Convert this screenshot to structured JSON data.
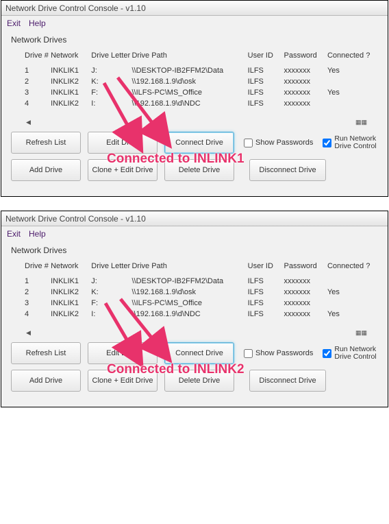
{
  "window_title": "Network Drive Control Console - v1.10",
  "menu": {
    "exit": "Exit",
    "help": "Help"
  },
  "section_label": "Network Drives",
  "columns": {
    "num": "Drive #",
    "net": "Network",
    "letter": "Drive Letter",
    "path": "Drive Path",
    "uid": "User ID",
    "pwd": "Password",
    "conn": "Connected ?"
  },
  "scroll": {
    "left": "◀",
    "right": "▦▦"
  },
  "buttons": {
    "refresh": "Refresh List",
    "edit": "Edit Drive",
    "connect": "Connect Drive",
    "add": "Add Drive",
    "clone": "Clone + Edit Drive",
    "delete": "Delete Drive",
    "disconnect": "Disconnect Drive"
  },
  "checks": {
    "show_pwd": "Show Passwords",
    "run_line1": "Run Network",
    "run_line2": "Drive Control"
  },
  "panel1": {
    "rows": [
      {
        "num": "1",
        "net": "INKLIK1",
        "letter": "J:",
        "path": "\\\\DESKTOP-IB2FFM2\\Data",
        "uid": "ILFS",
        "pwd": "xxxxxxx",
        "conn": "Yes"
      },
      {
        "num": "2",
        "net": "INKLIK2",
        "letter": "K:",
        "path": "\\\\192.168.1.9\\d\\osk",
        "uid": "ILFS",
        "pwd": "xxxxxxx",
        "conn": ""
      },
      {
        "num": "3",
        "net": "INKLIK1",
        "letter": "F:",
        "path": "\\\\ILFS-PC\\MS_Office",
        "uid": "ILFS",
        "pwd": "xxxxxxx",
        "conn": "Yes"
      },
      {
        "num": "4",
        "net": "INKLIK2",
        "letter": "I:",
        "path": "\\\\192.168.1.9\\d\\NDC",
        "uid": "ILFS",
        "pwd": "xxxxxxx",
        "conn": ""
      }
    ],
    "annotation": "Connected to INLINK1"
  },
  "panel2": {
    "rows": [
      {
        "num": "1",
        "net": "INKLIK1",
        "letter": "J:",
        "path": "\\\\DESKTOP-IB2FFM2\\Data",
        "uid": "ILFS",
        "pwd": "xxxxxxx",
        "conn": ""
      },
      {
        "num": "2",
        "net": "INKLIK2",
        "letter": "K:",
        "path": "\\\\192.168.1.9\\d\\osk",
        "uid": "ILFS",
        "pwd": "xxxxxxx",
        "conn": "Yes"
      },
      {
        "num": "3",
        "net": "INKLIK1",
        "letter": "F:",
        "path": "\\\\ILFS-PC\\MS_Office",
        "uid": "ILFS",
        "pwd": "xxxxxxx",
        "conn": ""
      },
      {
        "num": "4",
        "net": "INKLIK2",
        "letter": "I:",
        "path": "\\\\192.168.1.9\\d\\NDC",
        "uid": "ILFS",
        "pwd": "xxxxxxx",
        "conn": "Yes"
      }
    ],
    "annotation": "Connected to INLINK2"
  }
}
